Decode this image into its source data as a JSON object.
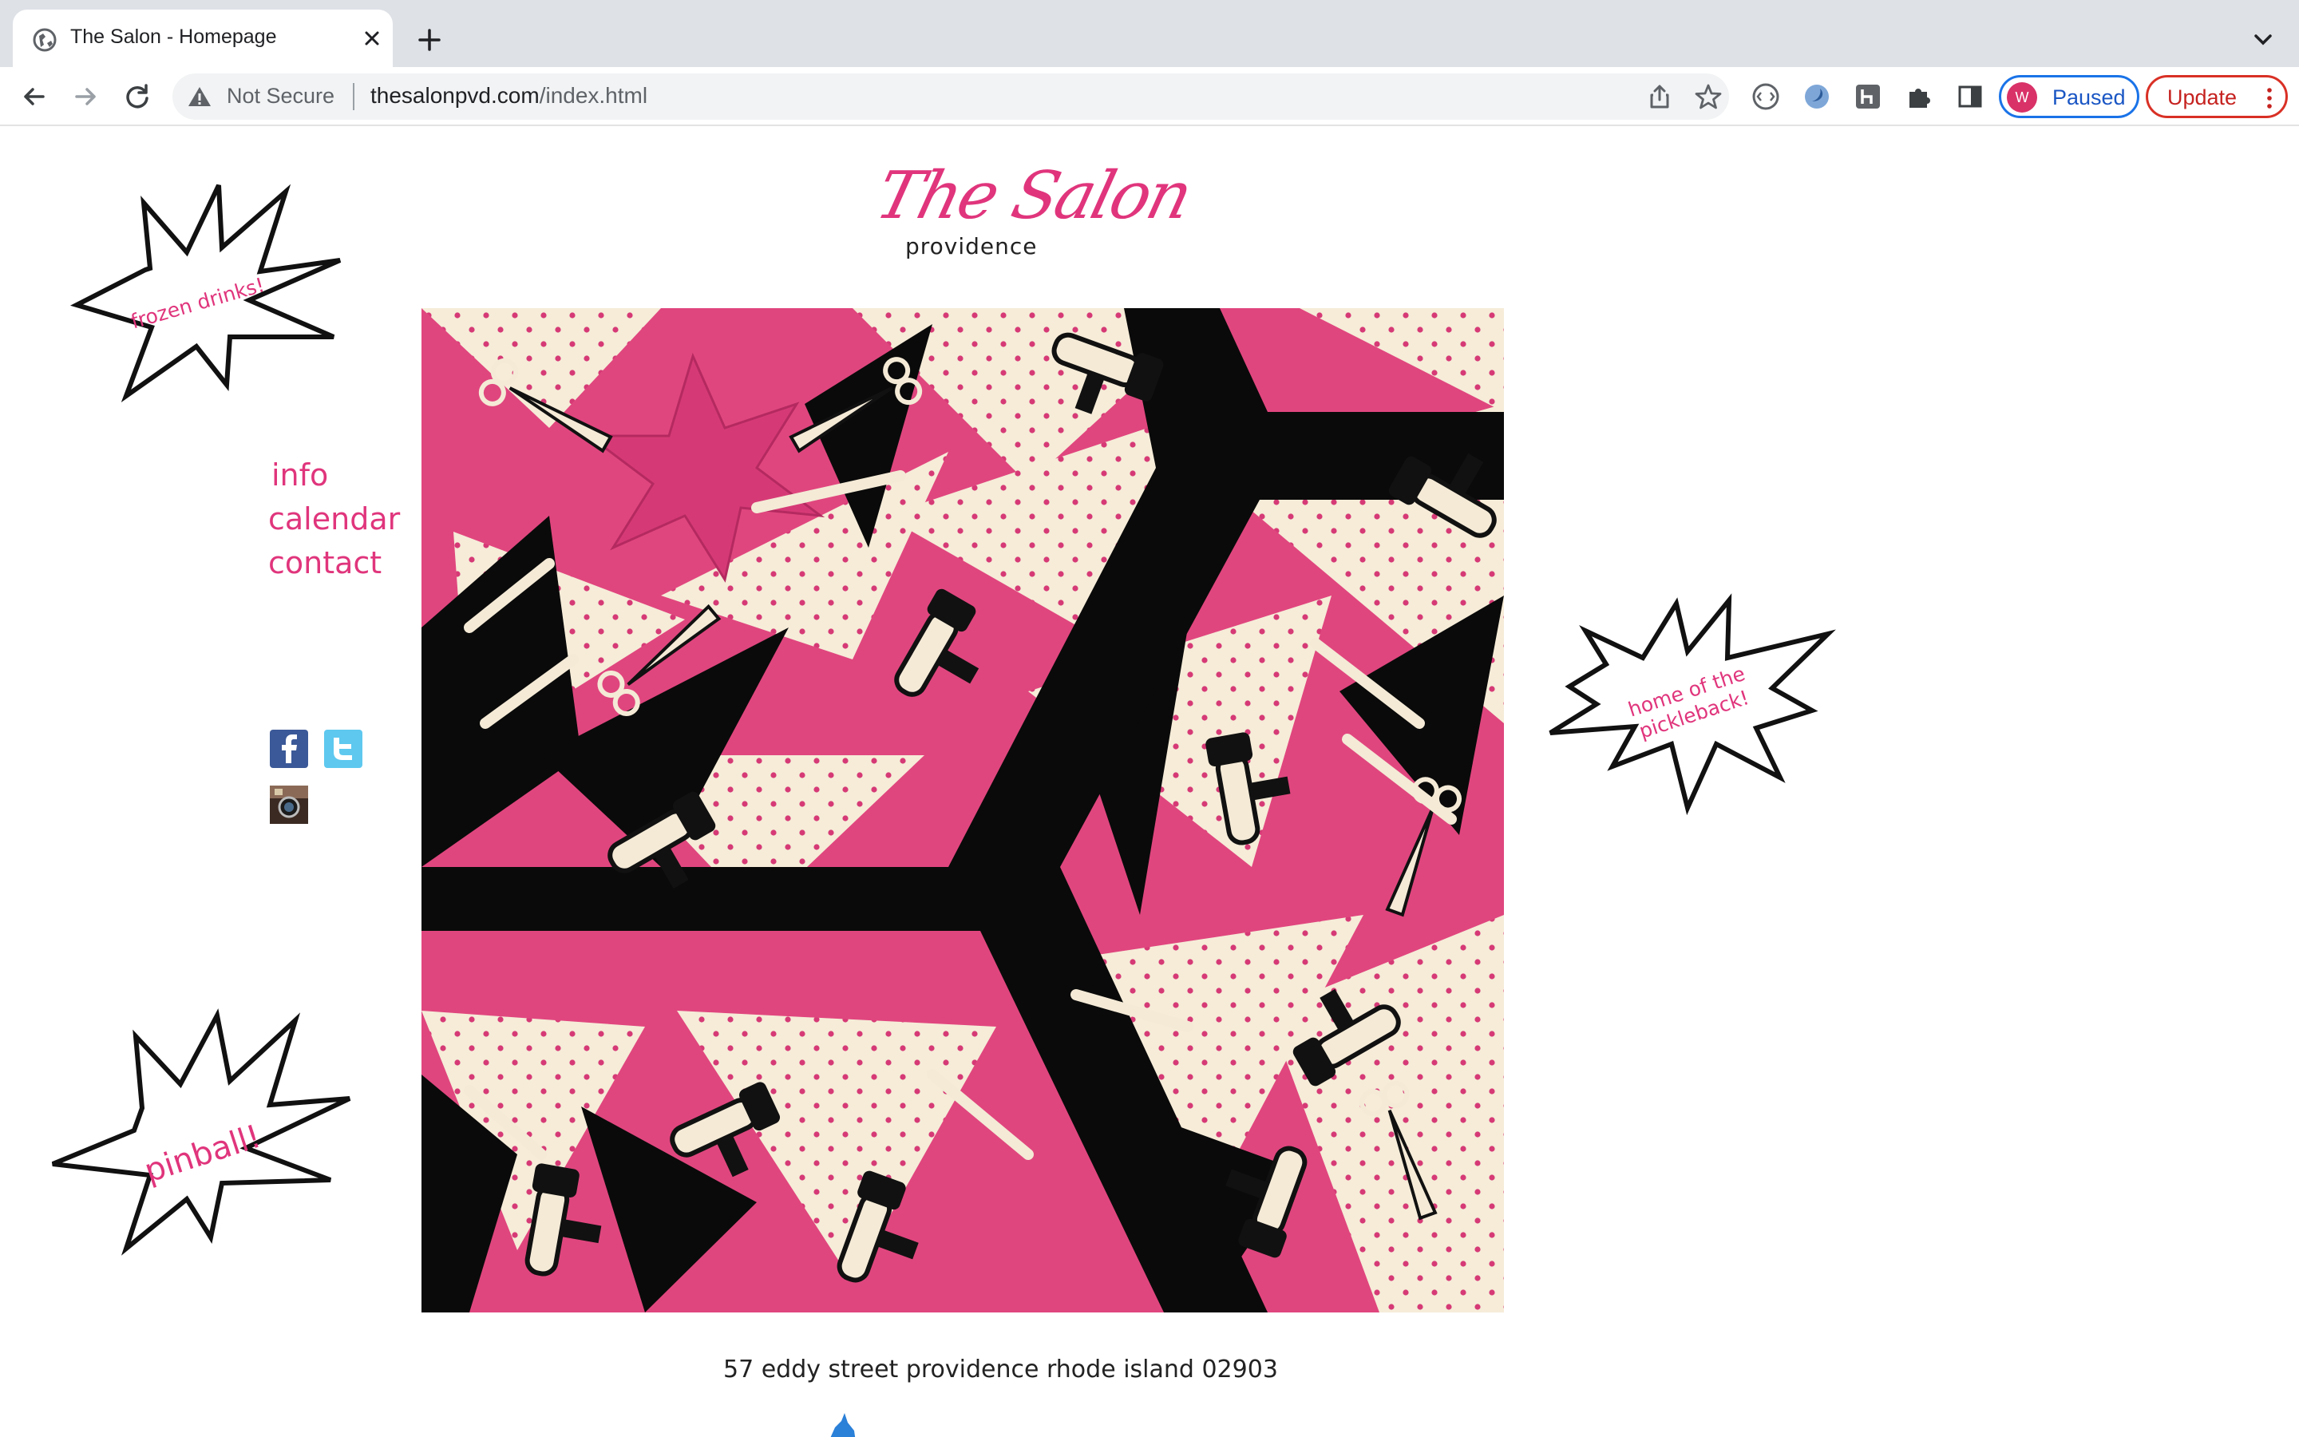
{
  "browser": {
    "tab_title": "The Salon - Homepage",
    "security_label": "Not Secure",
    "url_host": "thesalonpvd.com",
    "url_path": "/index.html",
    "profile_initial": "W",
    "profile_label": "Paused",
    "update_label": "Update"
  },
  "site": {
    "logo_script": "The Salon",
    "logo_sub": "providence",
    "nav": [
      "info",
      "calendar",
      "contact"
    ],
    "bursts": {
      "top_left": "frozen drinks!",
      "bottom_left": "pinball!",
      "right_line1": "home of the",
      "right_line2": "pickleback!"
    },
    "address": "57 eddy street providence rhode island 02903"
  },
  "colors": {
    "brand_pink": "#e0357c",
    "hero_pink": "#e0467e",
    "hero_cream": "#f6ecd8",
    "hero_black": "#0a0a0a"
  },
  "icons": {
    "social": [
      "facebook-icon",
      "twitter-icon",
      "instagram-icon"
    ]
  }
}
